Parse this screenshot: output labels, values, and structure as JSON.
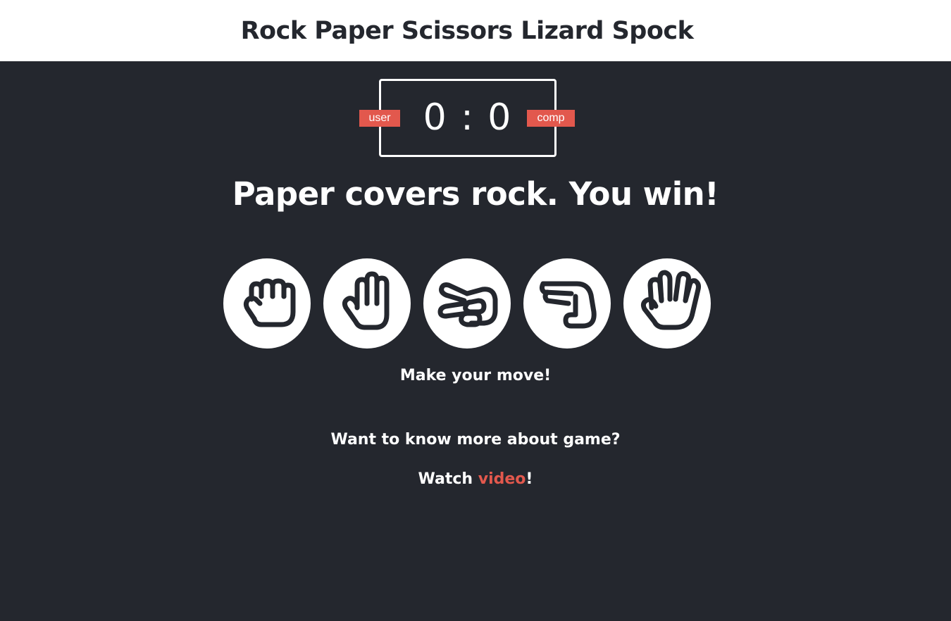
{
  "header": {
    "title": "Rock Paper Scissors Lizard Spock"
  },
  "scoreboard": {
    "user_label": "user",
    "comp_label": "comp",
    "score_display": "0 : 0",
    "user_score": 0,
    "comp_score": 0
  },
  "result": {
    "message": "Paper covers rock. You win!"
  },
  "choices": [
    {
      "name": "rock",
      "icon": "rock-hand-icon"
    },
    {
      "name": "paper",
      "icon": "paper-hand-icon"
    },
    {
      "name": "scissors",
      "icon": "scissors-hand-icon"
    },
    {
      "name": "lizard",
      "icon": "lizard-hand-icon"
    },
    {
      "name": "spock",
      "icon": "spock-hand-icon"
    }
  ],
  "prompt": {
    "text": "Make your move!"
  },
  "info": {
    "question": "Want to know more about game?",
    "watch_prefix": "Watch ",
    "watch_link": "video",
    "watch_suffix": "!"
  },
  "colors": {
    "background": "#24272e",
    "header_bg": "#ffffff",
    "accent": "#e2584d",
    "text": "#ffffff"
  }
}
